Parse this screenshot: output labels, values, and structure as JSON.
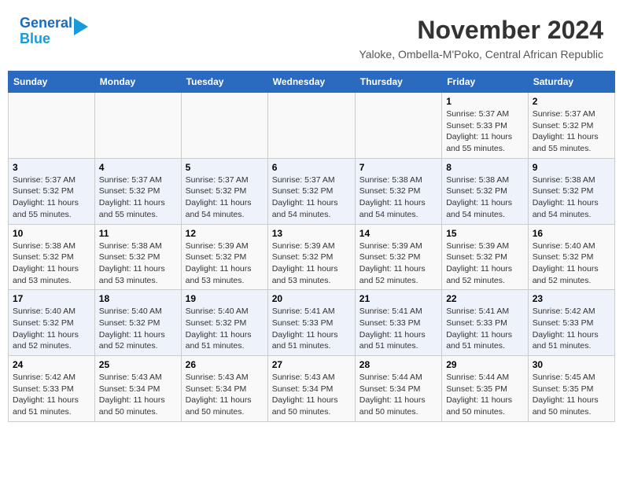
{
  "header": {
    "logo_line1": "General",
    "logo_line2": "Blue",
    "month": "November 2024",
    "location": "Yaloke, Ombella-M'Poko, Central African Republic"
  },
  "weekdays": [
    "Sunday",
    "Monday",
    "Tuesday",
    "Wednesday",
    "Thursday",
    "Friday",
    "Saturday"
  ],
  "weeks": [
    [
      {
        "day": "",
        "info": ""
      },
      {
        "day": "",
        "info": ""
      },
      {
        "day": "",
        "info": ""
      },
      {
        "day": "",
        "info": ""
      },
      {
        "day": "",
        "info": ""
      },
      {
        "day": "1",
        "info": "Sunrise: 5:37 AM\nSunset: 5:33 PM\nDaylight: 11 hours and 55 minutes."
      },
      {
        "day": "2",
        "info": "Sunrise: 5:37 AM\nSunset: 5:32 PM\nDaylight: 11 hours and 55 minutes."
      }
    ],
    [
      {
        "day": "3",
        "info": "Sunrise: 5:37 AM\nSunset: 5:32 PM\nDaylight: 11 hours and 55 minutes."
      },
      {
        "day": "4",
        "info": "Sunrise: 5:37 AM\nSunset: 5:32 PM\nDaylight: 11 hours and 55 minutes."
      },
      {
        "day": "5",
        "info": "Sunrise: 5:37 AM\nSunset: 5:32 PM\nDaylight: 11 hours and 54 minutes."
      },
      {
        "day": "6",
        "info": "Sunrise: 5:37 AM\nSunset: 5:32 PM\nDaylight: 11 hours and 54 minutes."
      },
      {
        "day": "7",
        "info": "Sunrise: 5:38 AM\nSunset: 5:32 PM\nDaylight: 11 hours and 54 minutes."
      },
      {
        "day": "8",
        "info": "Sunrise: 5:38 AM\nSunset: 5:32 PM\nDaylight: 11 hours and 54 minutes."
      },
      {
        "day": "9",
        "info": "Sunrise: 5:38 AM\nSunset: 5:32 PM\nDaylight: 11 hours and 54 minutes."
      }
    ],
    [
      {
        "day": "10",
        "info": "Sunrise: 5:38 AM\nSunset: 5:32 PM\nDaylight: 11 hours and 53 minutes."
      },
      {
        "day": "11",
        "info": "Sunrise: 5:38 AM\nSunset: 5:32 PM\nDaylight: 11 hours and 53 minutes."
      },
      {
        "day": "12",
        "info": "Sunrise: 5:39 AM\nSunset: 5:32 PM\nDaylight: 11 hours and 53 minutes."
      },
      {
        "day": "13",
        "info": "Sunrise: 5:39 AM\nSunset: 5:32 PM\nDaylight: 11 hours and 53 minutes."
      },
      {
        "day": "14",
        "info": "Sunrise: 5:39 AM\nSunset: 5:32 PM\nDaylight: 11 hours and 52 minutes."
      },
      {
        "day": "15",
        "info": "Sunrise: 5:39 AM\nSunset: 5:32 PM\nDaylight: 11 hours and 52 minutes."
      },
      {
        "day": "16",
        "info": "Sunrise: 5:40 AM\nSunset: 5:32 PM\nDaylight: 11 hours and 52 minutes."
      }
    ],
    [
      {
        "day": "17",
        "info": "Sunrise: 5:40 AM\nSunset: 5:32 PM\nDaylight: 11 hours and 52 minutes."
      },
      {
        "day": "18",
        "info": "Sunrise: 5:40 AM\nSunset: 5:32 PM\nDaylight: 11 hours and 52 minutes."
      },
      {
        "day": "19",
        "info": "Sunrise: 5:40 AM\nSunset: 5:32 PM\nDaylight: 11 hours and 51 minutes."
      },
      {
        "day": "20",
        "info": "Sunrise: 5:41 AM\nSunset: 5:33 PM\nDaylight: 11 hours and 51 minutes."
      },
      {
        "day": "21",
        "info": "Sunrise: 5:41 AM\nSunset: 5:33 PM\nDaylight: 11 hours and 51 minutes."
      },
      {
        "day": "22",
        "info": "Sunrise: 5:41 AM\nSunset: 5:33 PM\nDaylight: 11 hours and 51 minutes."
      },
      {
        "day": "23",
        "info": "Sunrise: 5:42 AM\nSunset: 5:33 PM\nDaylight: 11 hours and 51 minutes."
      }
    ],
    [
      {
        "day": "24",
        "info": "Sunrise: 5:42 AM\nSunset: 5:33 PM\nDaylight: 11 hours and 51 minutes."
      },
      {
        "day": "25",
        "info": "Sunrise: 5:43 AM\nSunset: 5:34 PM\nDaylight: 11 hours and 50 minutes."
      },
      {
        "day": "26",
        "info": "Sunrise: 5:43 AM\nSunset: 5:34 PM\nDaylight: 11 hours and 50 minutes."
      },
      {
        "day": "27",
        "info": "Sunrise: 5:43 AM\nSunset: 5:34 PM\nDaylight: 11 hours and 50 minutes."
      },
      {
        "day": "28",
        "info": "Sunrise: 5:44 AM\nSunset: 5:34 PM\nDaylight: 11 hours and 50 minutes."
      },
      {
        "day": "29",
        "info": "Sunrise: 5:44 AM\nSunset: 5:35 PM\nDaylight: 11 hours and 50 minutes."
      },
      {
        "day": "30",
        "info": "Sunrise: 5:45 AM\nSunset: 5:35 PM\nDaylight: 11 hours and 50 minutes."
      }
    ]
  ]
}
